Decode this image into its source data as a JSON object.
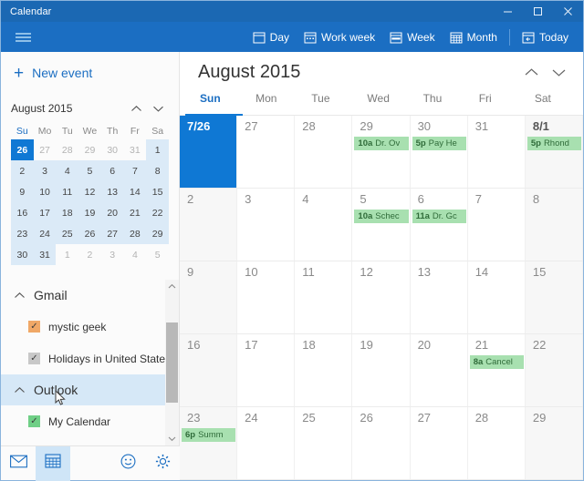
{
  "window": {
    "title": "Calendar",
    "minimize_label": "Minimize",
    "maximize_label": "Maximize",
    "close_label": "Close"
  },
  "commandbar": {
    "menu_label": "Menu",
    "views": [
      {
        "label": "Day",
        "icon": "calendar-day-icon"
      },
      {
        "label": "Work week",
        "icon": "calendar-work-week-icon"
      },
      {
        "label": "Week",
        "icon": "calendar-week-icon"
      },
      {
        "label": "Month",
        "icon": "calendar-month-icon"
      }
    ],
    "today": {
      "label": "Today",
      "icon": "calendar-today-icon"
    }
  },
  "sidebar": {
    "new_event_label": "New event",
    "mini_calendar": {
      "title": "August 2015",
      "prev_label": "Previous month",
      "next_label": "Next month",
      "weekday_headers": [
        "Su",
        "Mo",
        "Tu",
        "We",
        "Th",
        "Fr",
        "Sa"
      ],
      "weeks": [
        [
          {
            "n": "26",
            "state": "selected"
          },
          {
            "n": "27",
            "state": "out"
          },
          {
            "n": "28",
            "state": "out"
          },
          {
            "n": "29",
            "state": "out"
          },
          {
            "n": "30",
            "state": "out"
          },
          {
            "n": "31",
            "state": "out"
          },
          {
            "n": "1",
            "state": "inmonth"
          }
        ],
        [
          {
            "n": "2",
            "state": "inmonth"
          },
          {
            "n": "3",
            "state": "inmonth"
          },
          {
            "n": "4",
            "state": "inmonth"
          },
          {
            "n": "5",
            "state": "inmonth"
          },
          {
            "n": "6",
            "state": "inmonth"
          },
          {
            "n": "7",
            "state": "inmonth"
          },
          {
            "n": "8",
            "state": "inmonth"
          }
        ],
        [
          {
            "n": "9",
            "state": "inmonth"
          },
          {
            "n": "10",
            "state": "inmonth"
          },
          {
            "n": "11",
            "state": "inmonth"
          },
          {
            "n": "12",
            "state": "inmonth"
          },
          {
            "n": "13",
            "state": "inmonth"
          },
          {
            "n": "14",
            "state": "inmonth"
          },
          {
            "n": "15",
            "state": "inmonth"
          }
        ],
        [
          {
            "n": "16",
            "state": "inmonth"
          },
          {
            "n": "17",
            "state": "inmonth"
          },
          {
            "n": "18",
            "state": "inmonth"
          },
          {
            "n": "19",
            "state": "inmonth"
          },
          {
            "n": "20",
            "state": "inmonth"
          },
          {
            "n": "21",
            "state": "inmonth"
          },
          {
            "n": "22",
            "state": "inmonth"
          }
        ],
        [
          {
            "n": "23",
            "state": "inmonth"
          },
          {
            "n": "24",
            "state": "inmonth"
          },
          {
            "n": "25",
            "state": "inmonth"
          },
          {
            "n": "26",
            "state": "inmonth"
          },
          {
            "n": "27",
            "state": "inmonth"
          },
          {
            "n": "28",
            "state": "inmonth"
          },
          {
            "n": "29",
            "state": "inmonth"
          }
        ],
        [
          {
            "n": "30",
            "state": "inmonth"
          },
          {
            "n": "31",
            "state": "inmonth"
          },
          {
            "n": "1",
            "state": "out"
          },
          {
            "n": "2",
            "state": "out"
          },
          {
            "n": "3",
            "state": "out"
          },
          {
            "n": "4",
            "state": "out"
          },
          {
            "n": "5",
            "state": "out"
          }
        ]
      ]
    },
    "accounts": [
      {
        "name": "Gmail",
        "highlighted": false,
        "calendars": [
          {
            "label": "mystic geek",
            "checked": true,
            "color": "#f0a867"
          },
          {
            "label": "Holidays in United States",
            "checked": true,
            "color": "#c8c8c8"
          }
        ]
      },
      {
        "name": "Outlook",
        "highlighted": true,
        "calendars": [
          {
            "label": "My Calendar",
            "checked": true,
            "color": "#6fcf86"
          }
        ]
      }
    ],
    "scrollbar": {
      "up_label": "Scroll up",
      "down_label": "Scroll down"
    }
  },
  "bottombar": {
    "mail_label": "Mail",
    "calendar_label": "Calendar",
    "feedback_label": "Feedback",
    "settings_label": "Settings"
  },
  "main": {
    "month_title": "August 2015",
    "prev_label": "Previous",
    "next_label": "Next",
    "weekday_headers": [
      "Sun",
      "Mon",
      "Tue",
      "Wed",
      "Thu",
      "Fri",
      "Sat"
    ],
    "weeks": [
      [
        {
          "num": "7/26",
          "selected": true,
          "weekend": true,
          "events": []
        },
        {
          "num": "27",
          "events": []
        },
        {
          "num": "28",
          "events": []
        },
        {
          "num": "29",
          "events": [
            {
              "time": "10a",
              "title": "Dr. Ov"
            }
          ]
        },
        {
          "num": "30",
          "events": [
            {
              "time": "5p",
              "title": "Pay He"
            }
          ]
        },
        {
          "num": "31",
          "events": []
        },
        {
          "num": "8/1",
          "first_of_month": true,
          "weekend": true,
          "events": [
            {
              "time": "5p",
              "title": "Rhond"
            }
          ]
        }
      ],
      [
        {
          "num": "2",
          "weekend": true,
          "events": []
        },
        {
          "num": "3",
          "events": []
        },
        {
          "num": "4",
          "events": []
        },
        {
          "num": "5",
          "events": [
            {
              "time": "10a",
              "title": "Schec"
            }
          ]
        },
        {
          "num": "6",
          "events": [
            {
              "time": "11a",
              "title": "Dr. Gc"
            }
          ]
        },
        {
          "num": "7",
          "events": []
        },
        {
          "num": "8",
          "weekend": true,
          "events": []
        }
      ],
      [
        {
          "num": "9",
          "weekend": true,
          "events": []
        },
        {
          "num": "10",
          "events": []
        },
        {
          "num": "11",
          "events": []
        },
        {
          "num": "12",
          "events": []
        },
        {
          "num": "13",
          "events": []
        },
        {
          "num": "14",
          "events": []
        },
        {
          "num": "15",
          "weekend": true,
          "events": []
        }
      ],
      [
        {
          "num": "16",
          "weekend": true,
          "events": []
        },
        {
          "num": "17",
          "events": []
        },
        {
          "num": "18",
          "events": []
        },
        {
          "num": "19",
          "events": []
        },
        {
          "num": "20",
          "events": []
        },
        {
          "num": "21",
          "events": [
            {
              "time": "8a",
              "title": "Cancel"
            }
          ]
        },
        {
          "num": "22",
          "weekend": true,
          "events": []
        }
      ],
      [
        {
          "num": "23",
          "weekend": true,
          "events": [
            {
              "time": "6p",
              "title": "Summ"
            }
          ]
        },
        {
          "num": "24",
          "events": []
        },
        {
          "num": "25",
          "events": []
        },
        {
          "num": "26",
          "events": []
        },
        {
          "num": "27",
          "events": []
        },
        {
          "num": "28",
          "events": []
        },
        {
          "num": "29",
          "weekend": true,
          "events": []
        }
      ]
    ],
    "event_color": "#a8e0b0",
    "selected_color": "#0f78d4"
  }
}
